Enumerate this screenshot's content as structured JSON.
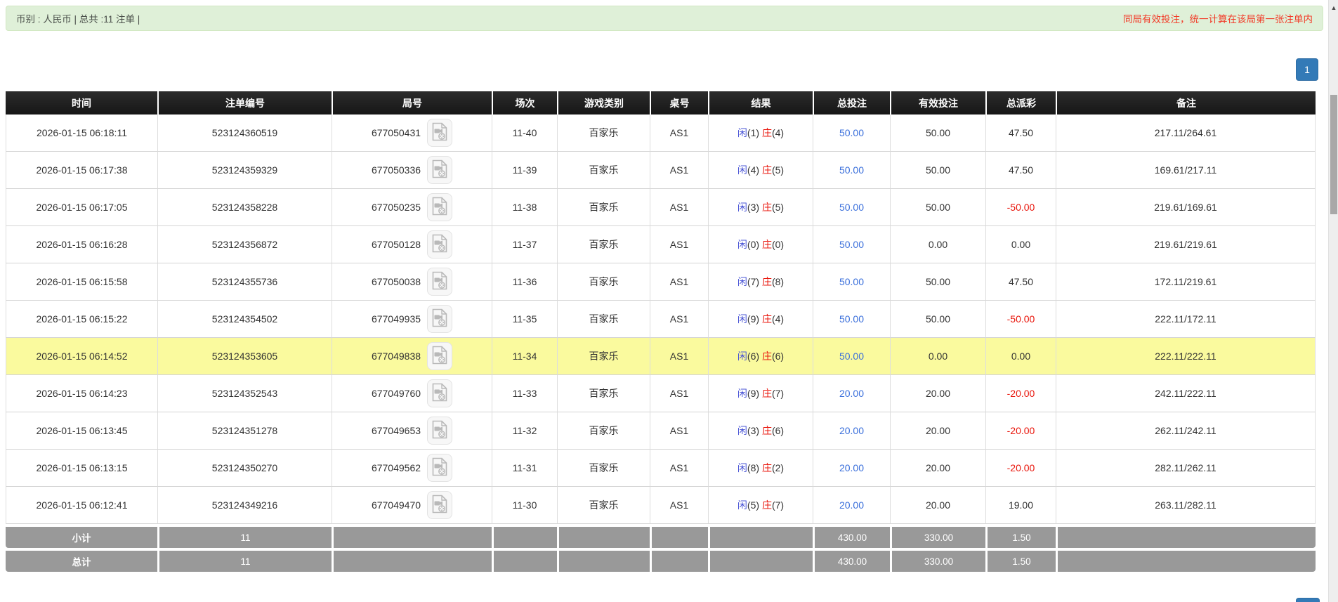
{
  "alert": {
    "summary": "币别 : 人民币 | 总共 :11 注单 |",
    "notice": "同局有效投注，统一计算在该局第一张注单内"
  },
  "pagination": {
    "current_page": "1"
  },
  "table": {
    "columns": [
      "时间",
      "注单编号",
      "局号",
      "场次",
      "游戏类别",
      "桌号",
      "结果",
      "总投注",
      "有效投注",
      "总派彩",
      "备注"
    ],
    "rows": [
      {
        "time": "2026-01-15 06:18:11",
        "bet_id": "523124360519",
        "round_no": "677050431",
        "session": "11-40",
        "game": "百家乐",
        "table_no": "AS1",
        "result": {
          "player": "闲",
          "player_score": "(1)",
          "banker": "庄",
          "banker_score": "(4)"
        },
        "total_bet": "50.00",
        "valid_bet": "50.00",
        "payout": "47.50",
        "remark": "217.11/264.61",
        "highlight": false
      },
      {
        "time": "2026-01-15 06:17:38",
        "bet_id": "523124359329",
        "round_no": "677050336",
        "session": "11-39",
        "game": "百家乐",
        "table_no": "AS1",
        "result": {
          "player": "闲",
          "player_score": "(4)",
          "banker": "庄",
          "banker_score": "(5)"
        },
        "total_bet": "50.00",
        "valid_bet": "50.00",
        "payout": "47.50",
        "remark": "169.61/217.11",
        "highlight": false
      },
      {
        "time": "2026-01-15 06:17:05",
        "bet_id": "523124358228",
        "round_no": "677050235",
        "session": "11-38",
        "game": "百家乐",
        "table_no": "AS1",
        "result": {
          "player": "闲",
          "player_score": "(3)",
          "banker": "庄",
          "banker_score": "(5)"
        },
        "total_bet": "50.00",
        "valid_bet": "50.00",
        "payout": "-50.00",
        "remark": "219.61/169.61",
        "highlight": false
      },
      {
        "time": "2026-01-15 06:16:28",
        "bet_id": "523124356872",
        "round_no": "677050128",
        "session": "11-37",
        "game": "百家乐",
        "table_no": "AS1",
        "result": {
          "player": "闲",
          "player_score": "(0)",
          "banker": "庄",
          "banker_score": "(0)"
        },
        "total_bet": "50.00",
        "valid_bet": "0.00",
        "payout": "0.00",
        "remark": "219.61/219.61",
        "highlight": false
      },
      {
        "time": "2026-01-15 06:15:58",
        "bet_id": "523124355736",
        "round_no": "677050038",
        "session": "11-36",
        "game": "百家乐",
        "table_no": "AS1",
        "result": {
          "player": "闲",
          "player_score": "(7)",
          "banker": "庄",
          "banker_score": "(8)"
        },
        "total_bet": "50.00",
        "valid_bet": "50.00",
        "payout": "47.50",
        "remark": "172.11/219.61",
        "highlight": false
      },
      {
        "time": "2026-01-15 06:15:22",
        "bet_id": "523124354502",
        "round_no": "677049935",
        "session": "11-35",
        "game": "百家乐",
        "table_no": "AS1",
        "result": {
          "player": "闲",
          "player_score": "(9)",
          "banker": "庄",
          "banker_score": "(4)"
        },
        "total_bet": "50.00",
        "valid_bet": "50.00",
        "payout": "-50.00",
        "remark": "222.11/172.11",
        "highlight": false
      },
      {
        "time": "2026-01-15 06:14:52",
        "bet_id": "523124353605",
        "round_no": "677049838",
        "session": "11-34",
        "game": "百家乐",
        "table_no": "AS1",
        "result": {
          "player": "闲",
          "player_score": "(6)",
          "banker": "庄",
          "banker_score": "(6)"
        },
        "total_bet": "50.00",
        "valid_bet": "0.00",
        "payout": "0.00",
        "remark": "222.11/222.11",
        "highlight": true
      },
      {
        "time": "2026-01-15 06:14:23",
        "bet_id": "523124352543",
        "round_no": "677049760",
        "session": "11-33",
        "game": "百家乐",
        "table_no": "AS1",
        "result": {
          "player": "闲",
          "player_score": "(9)",
          "banker": "庄",
          "banker_score": "(7)"
        },
        "total_bet": "20.00",
        "valid_bet": "20.00",
        "payout": "-20.00",
        "remark": "242.11/222.11",
        "highlight": false
      },
      {
        "time": "2026-01-15 06:13:45",
        "bet_id": "523124351278",
        "round_no": "677049653",
        "session": "11-32",
        "game": "百家乐",
        "table_no": "AS1",
        "result": {
          "player": "闲",
          "player_score": "(3)",
          "banker": "庄",
          "banker_score": "(6)"
        },
        "total_bet": "20.00",
        "valid_bet": "20.00",
        "payout": "-20.00",
        "remark": "262.11/242.11",
        "highlight": false
      },
      {
        "time": "2026-01-15 06:13:15",
        "bet_id": "523124350270",
        "round_no": "677049562",
        "session": "11-31",
        "game": "百家乐",
        "table_no": "AS1",
        "result": {
          "player": "闲",
          "player_score": "(8)",
          "banker": "庄",
          "banker_score": "(2)"
        },
        "total_bet": "20.00",
        "valid_bet": "20.00",
        "payout": "-20.00",
        "remark": "282.11/262.11",
        "highlight": false
      },
      {
        "time": "2026-01-15 06:12:41",
        "bet_id": "523124349216",
        "round_no": "677049470",
        "session": "11-30",
        "game": "百家乐",
        "table_no": "AS1",
        "result": {
          "player": "闲",
          "player_score": "(5)",
          "banker": "庄",
          "banker_score": "(7)"
        },
        "total_bet": "20.00",
        "valid_bet": "20.00",
        "payout": "19.00",
        "remark": "263.11/282.11",
        "highlight": false
      }
    ],
    "subtotal": {
      "label": "小计",
      "count": "11",
      "total_bet": "430.00",
      "valid_bet": "330.00",
      "payout": "1.50"
    },
    "total": {
      "label": "总计",
      "count": "11",
      "total_bet": "430.00",
      "valid_bet": "330.00",
      "payout": "1.50"
    }
  },
  "icons": {
    "round_cell_icon": "video-replay-icon",
    "scroll_icon": "scroll-up-arrow"
  },
  "colors": {
    "alert_bg": "#dff0d8",
    "notice_red": "#f23b28",
    "header_bg": "#222222",
    "highlight_row": "#fafa9e",
    "link_blue": "#3a6fdb",
    "player_blue": "#4a55d6",
    "banker_red": "#e9150b",
    "footer_gray": "#999999",
    "pagination_blue": "#337ab7"
  }
}
